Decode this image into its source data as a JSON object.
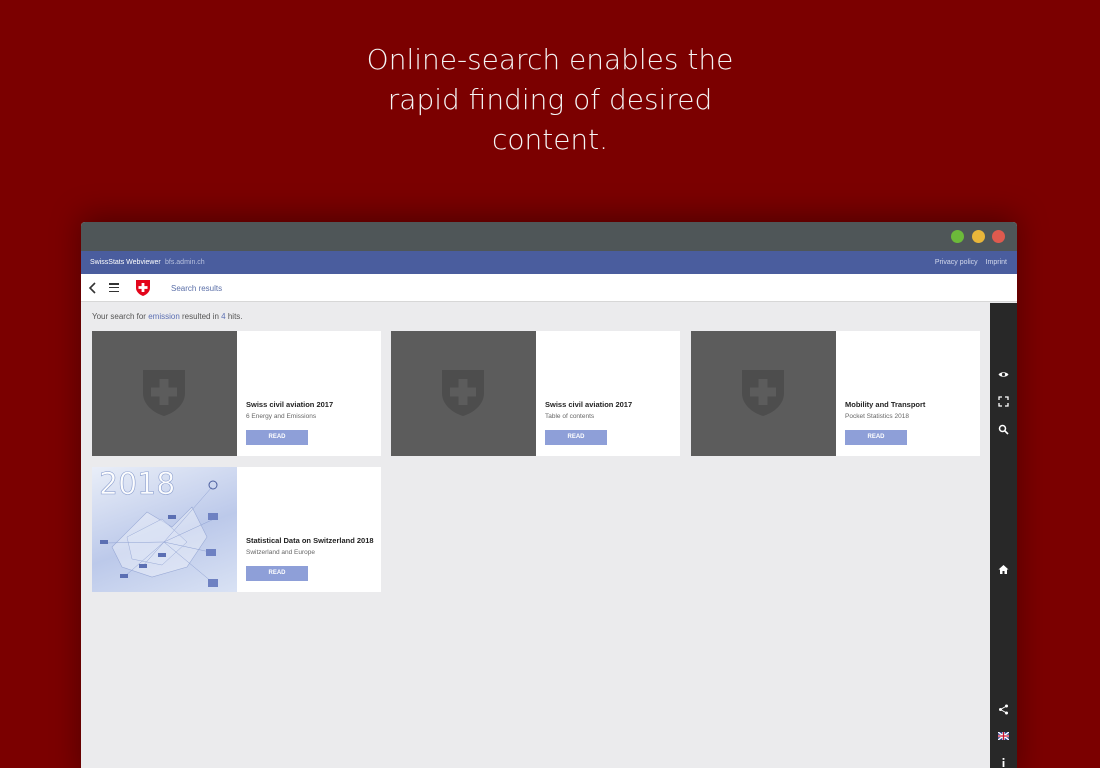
{
  "headline": {
    "line1": "Online-search enables the",
    "line2": "rapid finding of desired",
    "line3": "content."
  },
  "window": {
    "controls": [
      "green",
      "yellow",
      "red"
    ]
  },
  "appbar": {
    "brand": "SwissStats Webviewer",
    "domain": "bfs.admin.ch",
    "privacy": "Privacy policy",
    "imprint": "Imprint"
  },
  "toolbar": {
    "title": "Search results",
    "icons": [
      "back-icon",
      "menu-icon",
      "swiss-crest-logo"
    ]
  },
  "search": {
    "prefix": "Your search for",
    "term": "emission",
    "middle": "resulted in",
    "count": "4",
    "suffix": "hits."
  },
  "results": [
    {
      "title": "Swiss civil aviation 2017",
      "subtitle": "6 Energy and Emissions",
      "button": "READ"
    },
    {
      "title": "Swiss civil aviation 2017",
      "subtitle": "Table of contents",
      "button": "READ"
    },
    {
      "title": "Mobility and Transport",
      "subtitle": "Pocket Statistics 2018",
      "button": "READ"
    },
    {
      "title": "Statistical Data on Switzerland 2018",
      "subtitle": "Switzerland and Europe",
      "button": "READ",
      "cover_year": "2018"
    }
  ],
  "sidebar": {
    "icons": [
      "eye-icon",
      "fullscreen-icon",
      "search-icon",
      "home-icon",
      "share-icon",
      "uk-flag-icon",
      "info-icon"
    ]
  },
  "colors": {
    "background": "#7b0000",
    "appbar": "#4a5d9e",
    "button": "#8e9fd8",
    "sidebar": "#282828"
  }
}
